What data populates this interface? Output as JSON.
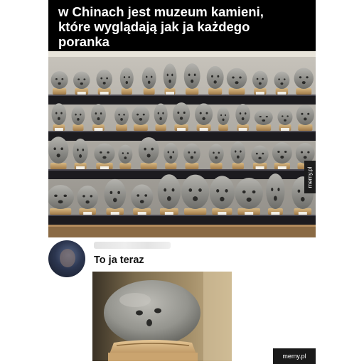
{
  "caption": {
    "lines": [
      "w Chinach jest muzeum kamieni,",
      "które wyglądają jak ja każdego",
      "poranka"
    ]
  },
  "post": {
    "text": "To ja teraz"
  },
  "watermark": {
    "side": "memy.pl",
    "footer": "memy.pl"
  },
  "colors": {
    "caption_bg": "#000000",
    "caption_text": "#ffffff",
    "shelf_dark": "#1c1b1f",
    "stone": "#8a8a86",
    "pedestal": "#c9a473"
  }
}
